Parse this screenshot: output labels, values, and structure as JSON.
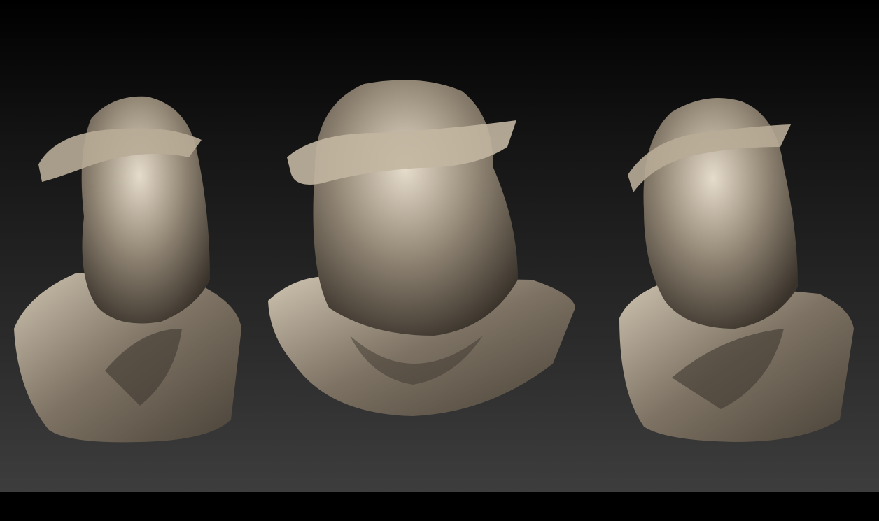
{
  "scene": {
    "subject": "bust",
    "views": [
      "left-three-quarter",
      "front",
      "right-three-quarter"
    ],
    "colors": {
      "background_top": "#000000",
      "background_bottom": "#3d3d3d",
      "metal_light": "#e6dccb",
      "metal_mid": "#9a8e7c",
      "metal_dark": "#3a332b"
    }
  }
}
